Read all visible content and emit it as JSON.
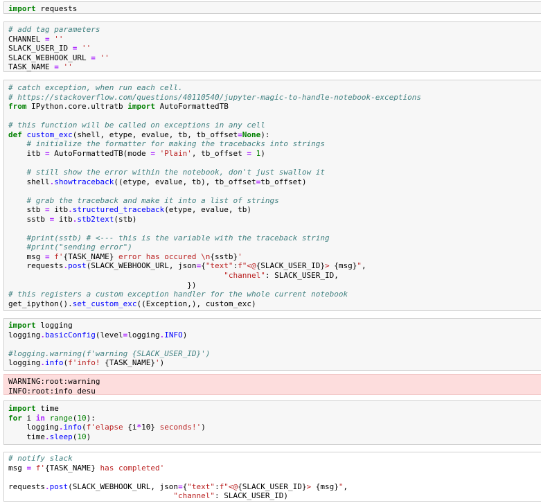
{
  "cells": [
    {
      "id": "cell-import-requests",
      "type": "code",
      "lines": [
        [
          {
            "t": "import",
            "c": "kw"
          },
          {
            "t": " requests"
          }
        ]
      ]
    },
    {
      "id": "cell-tag-params",
      "type": "code",
      "lines": [
        [
          {
            "t": "# add tag parameters",
            "c": "cm"
          }
        ],
        [
          {
            "t": "CHANNEL "
          },
          {
            "t": "=",
            "c": "op"
          },
          {
            "t": " "
          },
          {
            "t": "''",
            "c": "st"
          }
        ],
        [
          {
            "t": "SLACK_USER_ID "
          },
          {
            "t": "=",
            "c": "op"
          },
          {
            "t": " "
          },
          {
            "t": "''",
            "c": "st"
          }
        ],
        [
          {
            "t": "SLACK_WEBHOOK_URL "
          },
          {
            "t": "=",
            "c": "op"
          },
          {
            "t": " "
          },
          {
            "t": "''",
            "c": "st"
          }
        ],
        [
          {
            "t": "TASK_NAME "
          },
          {
            "t": "=",
            "c": "op"
          },
          {
            "t": " "
          },
          {
            "t": "''",
            "c": "st"
          }
        ]
      ]
    },
    {
      "id": "cell-custom-exc",
      "type": "code",
      "lines": [
        [
          {
            "t": "# catch exception, when run each cell.",
            "c": "cm"
          }
        ],
        [
          {
            "t": "# https://stackoverflow.com/questions/40110540/jupyter-magic-to-handle-notebook-exceptions",
            "c": "cm"
          }
        ],
        [
          {
            "t": "from",
            "c": "kw"
          },
          {
            "t": " IPython.core.ultratb "
          },
          {
            "t": "import",
            "c": "kw"
          },
          {
            "t": " AutoFormattedTB"
          }
        ],
        [
          {
            "t": ""
          }
        ],
        [
          {
            "t": "# this function will be called on exceptions in any cell",
            "c": "cm"
          }
        ],
        [
          {
            "t": "def",
            "c": "kw"
          },
          {
            "t": " "
          },
          {
            "t": "custom_exc",
            "c": "fn"
          },
          {
            "t": "(shell, etype, evalue, tb, tb_offset"
          },
          {
            "t": "=",
            "c": "op"
          },
          {
            "t": "None",
            "c": "kwc"
          },
          {
            "t": "):"
          }
        ],
        [
          {
            "t": "    "
          },
          {
            "t": "# initialize the formatter for making the tracebacks into strings",
            "c": "cm"
          }
        ],
        [
          {
            "t": "    itb "
          },
          {
            "t": "=",
            "c": "op"
          },
          {
            "t": " AutoFormattedTB(mode "
          },
          {
            "t": "=",
            "c": "op"
          },
          {
            "t": " "
          },
          {
            "t": "'Plain'",
            "c": "st"
          },
          {
            "t": ", tb_offset "
          },
          {
            "t": "=",
            "c": "op"
          },
          {
            "t": " "
          },
          {
            "t": "1",
            "c": "nm"
          },
          {
            "t": ")"
          }
        ],
        [
          {
            "t": ""
          }
        ],
        [
          {
            "t": "    "
          },
          {
            "t": "# still show the error within the notebook, don't just swallow it",
            "c": "cm"
          }
        ],
        [
          {
            "t": "    shell"
          },
          {
            "t": ".",
            "c": "op"
          },
          {
            "t": "showtraceback",
            "c": "fn"
          },
          {
            "t": "((etype, evalue, tb), tb_offset"
          },
          {
            "t": "=",
            "c": "op"
          },
          {
            "t": "tb_offset)"
          }
        ],
        [
          {
            "t": ""
          }
        ],
        [
          {
            "t": "    "
          },
          {
            "t": "# grab the traceback and make it into a list of strings",
            "c": "cm"
          }
        ],
        [
          {
            "t": "    stb "
          },
          {
            "t": "=",
            "c": "op"
          },
          {
            "t": " itb"
          },
          {
            "t": ".",
            "c": "op"
          },
          {
            "t": "structured_traceback",
            "c": "fn"
          },
          {
            "t": "(etype, evalue, tb)"
          }
        ],
        [
          {
            "t": "    sstb "
          },
          {
            "t": "=",
            "c": "op"
          },
          {
            "t": " itb"
          },
          {
            "t": ".",
            "c": "op"
          },
          {
            "t": "stb2text",
            "c": "fn"
          },
          {
            "t": "(stb)"
          }
        ],
        [
          {
            "t": ""
          }
        ],
        [
          {
            "t": "    "
          },
          {
            "t": "#print(sstb) # <--- this is the variable with the traceback string",
            "c": "cm"
          }
        ],
        [
          {
            "t": "    "
          },
          {
            "t": "#print(\"sending error\")",
            "c": "cm"
          }
        ],
        [
          {
            "t": "    msg "
          },
          {
            "t": "=",
            "c": "op"
          },
          {
            "t": " "
          },
          {
            "t": "f'",
            "c": "st"
          },
          {
            "t": "{TASK_NAME}"
          },
          {
            "t": " error has occured \\n",
            "c": "st"
          },
          {
            "t": "{sstb}"
          },
          {
            "t": "'",
            "c": "st"
          }
        ],
        [
          {
            "t": "    requests"
          },
          {
            "t": ".",
            "c": "op"
          },
          {
            "t": "post",
            "c": "fn"
          },
          {
            "t": "(SLACK_WEBHOOK_URL, json"
          },
          {
            "t": "=",
            "c": "op"
          },
          {
            "t": "{"
          },
          {
            "t": "\"text\"",
            "c": "st"
          },
          {
            "t": ":"
          },
          {
            "t": "f\"<@",
            "c": "st"
          },
          {
            "t": "{SLACK_USER_ID}"
          },
          {
            "t": "> ",
            "c": "st"
          },
          {
            "t": "{msg}"
          },
          {
            "t": "\"",
            "c": "st"
          },
          {
            "t": ","
          }
        ],
        [
          {
            "t": "                                               "
          },
          {
            "t": "\"channel\"",
            "c": "st"
          },
          {
            "t": ": SLACK_USER_ID,"
          }
        ],
        [
          {
            "t": "                                       })"
          }
        ],
        [
          {
            "t": "# this registers a custom exception handler for the whole current notebook",
            "c": "cm"
          }
        ],
        [
          {
            "t": "get_ipython"
          },
          {
            "t": "()",
            "c": ""
          },
          {
            "t": "."
          },
          {
            "t": "set_custom_exc",
            "c": "fn"
          },
          {
            "t": "((Exception,), custom_exc)"
          }
        ]
      ]
    },
    {
      "id": "cell-logging",
      "type": "code",
      "lines": [
        [
          {
            "t": "import",
            "c": "kw"
          },
          {
            "t": " logging"
          }
        ],
        [
          {
            "t": "logging"
          },
          {
            "t": ".",
            "c": "op"
          },
          {
            "t": "basicConfig",
            "c": "fn"
          },
          {
            "t": "(level"
          },
          {
            "t": "=",
            "c": "op"
          },
          {
            "t": "logging"
          },
          {
            "t": ".",
            "c": "op"
          },
          {
            "t": "INFO",
            "c": "fn"
          },
          {
            "t": ")"
          }
        ],
        [
          {
            "t": ""
          }
        ],
        [
          {
            "t": "#logging.warning(f'warning {SLACK_USER_ID}')",
            "c": "cm"
          }
        ],
        [
          {
            "t": "logging"
          },
          {
            "t": ".",
            "c": "op"
          },
          {
            "t": "info",
            "c": "fn"
          },
          {
            "t": "("
          },
          {
            "t": "f'info! ",
            "c": "st"
          },
          {
            "t": "{TASK_NAME}"
          },
          {
            "t": "'",
            "c": "st"
          },
          {
            "t": ")"
          }
        ]
      ]
    },
    {
      "id": "cell-stderr-output",
      "type": "output",
      "lines": [
        [
          {
            "t": "WARNING:root:warning"
          }
        ],
        [
          {
            "t": "INFO:root:info desu"
          }
        ]
      ]
    },
    {
      "id": "cell-time-loop",
      "type": "code",
      "lines": [
        [
          {
            "t": "import",
            "c": "kw"
          },
          {
            "t": " time"
          }
        ],
        [
          {
            "t": "for",
            "c": "kw"
          },
          {
            "t": " i "
          },
          {
            "t": "in",
            "c": "op"
          },
          {
            "t": " "
          },
          {
            "t": "range",
            "c": "bi"
          },
          {
            "t": "("
          },
          {
            "t": "10",
            "c": "nm"
          },
          {
            "t": "):"
          }
        ],
        [
          {
            "t": "    logging"
          },
          {
            "t": ".",
            "c": "op"
          },
          {
            "t": "info",
            "c": "fn"
          },
          {
            "t": "("
          },
          {
            "t": "f'elapse ",
            "c": "st"
          },
          {
            "t": "{i"
          },
          {
            "t": "*",
            "c": "op"
          },
          {
            "t": "10}"
          },
          {
            "t": " seconds!'",
            "c": "st"
          },
          {
            "t": ")"
          }
        ],
        [
          {
            "t": "    time"
          },
          {
            "t": ".",
            "c": "op"
          },
          {
            "t": "sleep",
            "c": "fn"
          },
          {
            "t": "("
          },
          {
            "t": "10",
            "c": "nm"
          },
          {
            "t": ")"
          }
        ]
      ]
    },
    {
      "id": "cell-notify-slack",
      "type": "code-active",
      "lines": [
        [
          {
            "t": "# notify slack",
            "c": "cm"
          }
        ],
        [
          {
            "t": "msg "
          },
          {
            "t": "=",
            "c": "op"
          },
          {
            "t": " "
          },
          {
            "t": "f'",
            "c": "st"
          },
          {
            "t": "{TASK_NAME}"
          },
          {
            "t": " has completed'",
            "c": "st"
          }
        ],
        [
          {
            "t": ""
          }
        ],
        [
          {
            "t": "requests"
          },
          {
            "t": ".",
            "c": "op"
          },
          {
            "t": "post",
            "c": "fn"
          },
          {
            "t": "(SLACK_WEBHOOK_URL, json"
          },
          {
            "t": "=",
            "c": "op"
          },
          {
            "t": "{"
          },
          {
            "t": "\"text\"",
            "c": "st"
          },
          {
            "t": ":"
          },
          {
            "t": "f\"<@",
            "c": "st"
          },
          {
            "t": "{SLACK_USER_ID}"
          },
          {
            "t": "> ",
            "c": "st"
          },
          {
            "t": "{msg}"
          },
          {
            "t": "\"",
            "c": "st"
          },
          {
            "t": ","
          }
        ],
        [
          {
            "t": "                                    "
          },
          {
            "t": "\"channel\"",
            "c": "st"
          },
          {
            "t": ": SLACK_USER_ID)"
          }
        ]
      ]
    }
  ]
}
